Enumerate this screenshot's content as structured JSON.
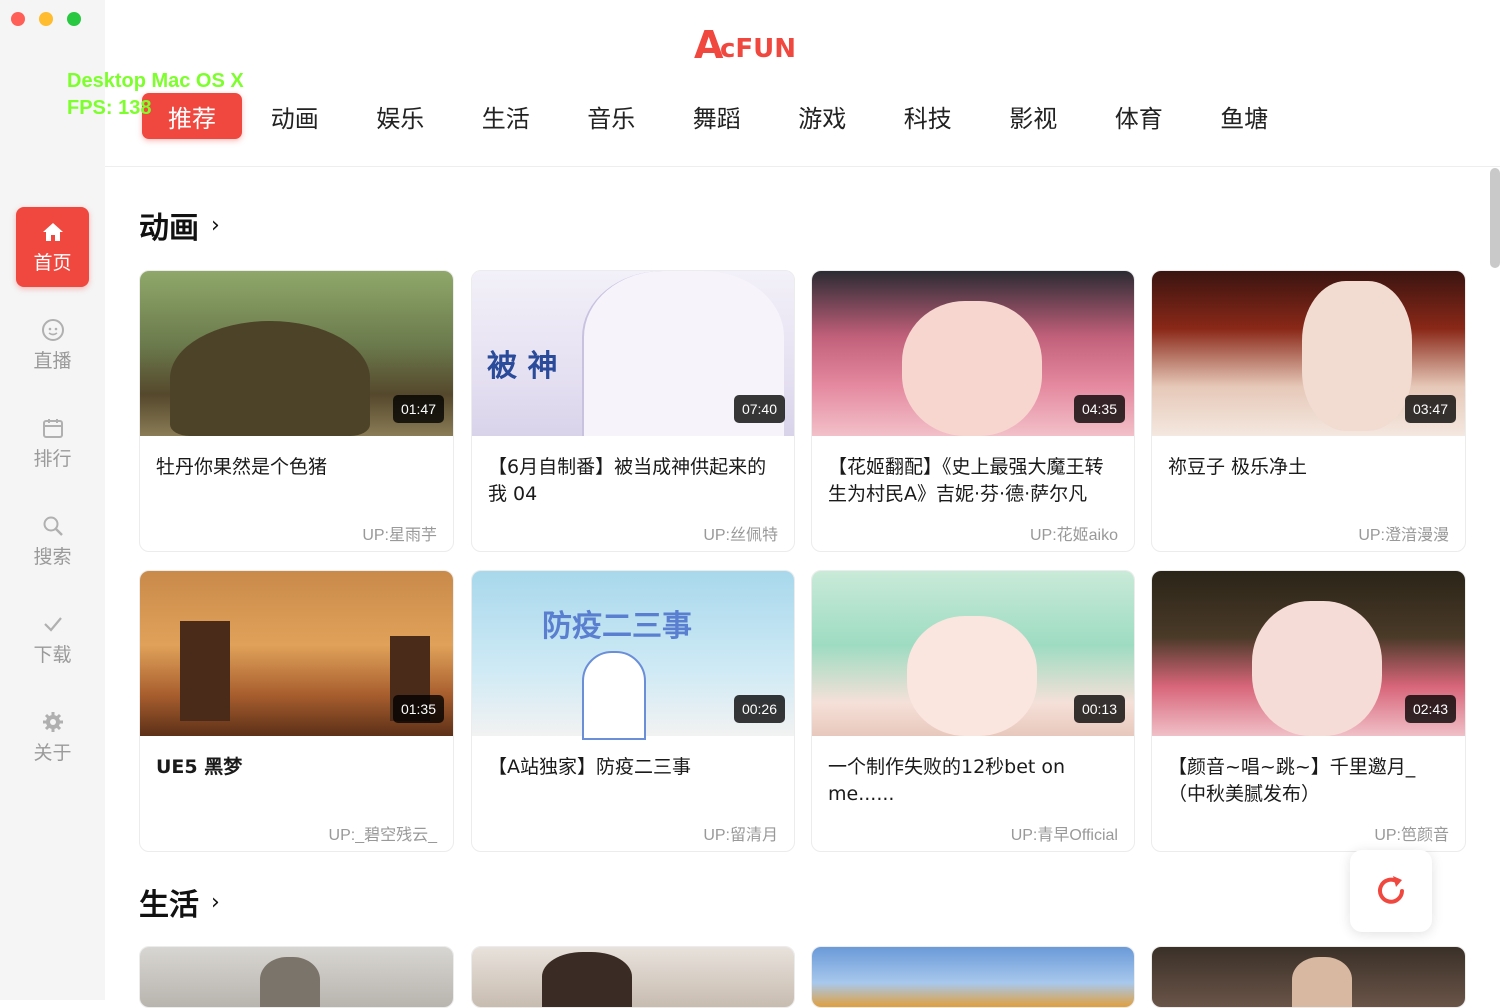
{
  "window": {
    "logo_text": "AcFun"
  },
  "overlay": {
    "line1": "Desktop Mac OS X",
    "line2": "FPS: 138"
  },
  "sidebar": {
    "items": [
      {
        "label": "首页",
        "icon": "home-icon"
      },
      {
        "label": "直播",
        "icon": "face-icon"
      },
      {
        "label": "排行",
        "icon": "calendar-icon"
      },
      {
        "label": "搜索",
        "icon": "search-icon"
      },
      {
        "label": "下载",
        "icon": "check-icon"
      },
      {
        "label": "关于",
        "icon": "gear-icon"
      }
    ]
  },
  "tabs": [
    "推荐",
    "动画",
    "娱乐",
    "生活",
    "音乐",
    "舞蹈",
    "游戏",
    "科技",
    "影视",
    "体育",
    "鱼塘"
  ],
  "sections": [
    {
      "title": "动画",
      "cards": [
        {
          "title": "牡丹你果然是个色猪",
          "up": "UP:星雨芋",
          "duration": "01:47"
        },
        {
          "title": "【6月自制番】被当成神供起来的我 04",
          "up": "UP:丝佩特",
          "duration": "07:40"
        },
        {
          "title": "【花姬翻配】《史上最强大魔王转生为村民A》吉妮·芬·德·萨尔凡",
          "up": "UP:花姬aiko",
          "duration": "04:35"
        },
        {
          "title": "祢豆子 极乐净土",
          "up": "UP:澄湆漫漫",
          "duration": "03:47"
        },
        {
          "title": "UE5 黑梦",
          "up": "UP:_碧空残云_",
          "duration": "01:35"
        },
        {
          "title": "【A站独家】防疫二三事",
          "up": "UP:留清月",
          "duration": "00:26"
        },
        {
          "title": "一个制作失败的12秒bet on me......",
          "up": "UP:青早Official",
          "duration": "00:13"
        },
        {
          "title": "【颜音~唱~跳~】千里邀月_（中秋美腻发布）",
          "up": "UP:笆颜音",
          "duration": "02:43"
        }
      ]
    },
    {
      "title": "生活",
      "cards": []
    }
  ],
  "colors": {
    "accent": "#f0473f",
    "sidebar_bg": "#f5f5f5"
  }
}
